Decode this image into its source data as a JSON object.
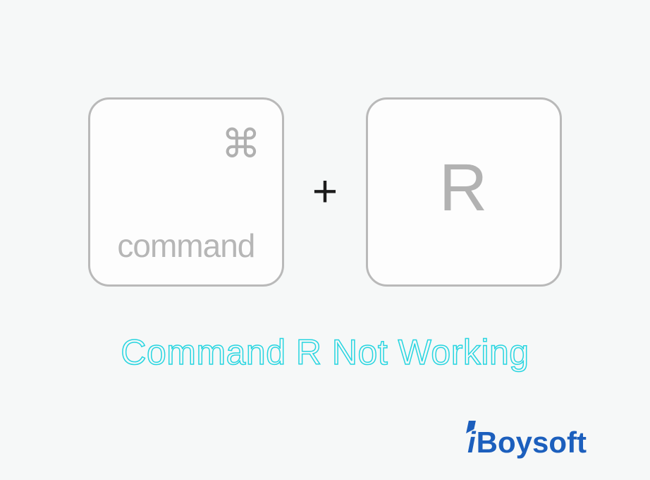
{
  "keys": {
    "left_label": "command",
    "command_symbol": "⌘",
    "plus": "+",
    "right_label": "R"
  },
  "heading": "Command R Not Working",
  "brand": {
    "i": "i",
    "rest": "Boysoft"
  }
}
